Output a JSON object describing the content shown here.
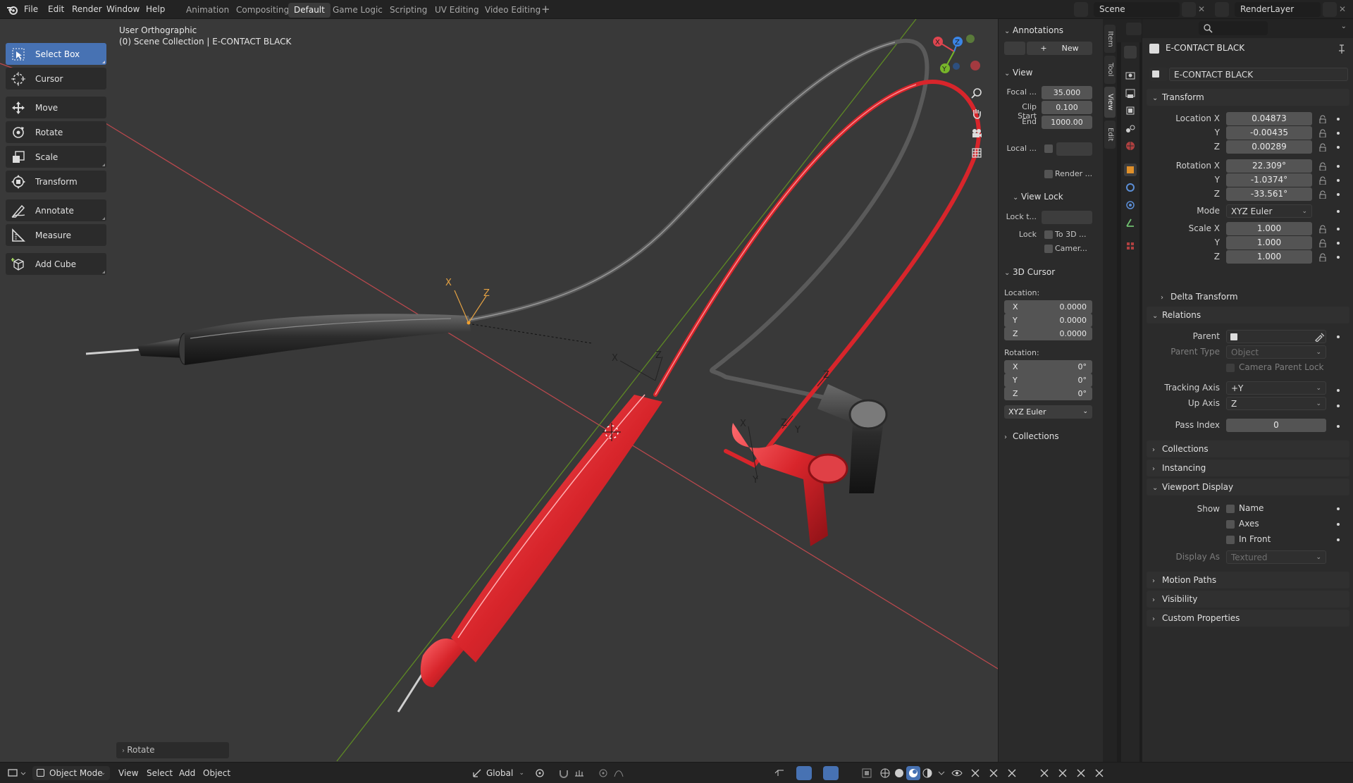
{
  "menu": [
    "File",
    "Edit",
    "Render",
    "Window",
    "Help"
  ],
  "workspaces": [
    "Animation",
    "Compositing",
    "Default",
    "Game Logic",
    "Scripting",
    "UV Editing",
    "Video Editing"
  ],
  "active_workspace": "Default",
  "add_workspace_icon": "plus-icon",
  "scene_name": "Scene",
  "view_layer": "RenderLayer",
  "viewport": {
    "view_name": "User Orthographic",
    "collection_line": "(0) Scene Collection | E-CONTACT BLACK"
  },
  "tools": [
    {
      "label": "Select Box",
      "icon": "select-box-icon",
      "active": true
    },
    {
      "label": "Cursor",
      "icon": "cursor-icon"
    },
    {
      "label": "Move",
      "icon": "move-icon"
    },
    {
      "label": "Rotate",
      "icon": "rotate-icon"
    },
    {
      "label": "Scale",
      "icon": "scale-icon"
    },
    {
      "label": "Transform",
      "icon": "transform-icon"
    },
    {
      "label": "Annotate",
      "icon": "annotate-icon"
    },
    {
      "label": "Measure",
      "icon": "measure-icon"
    },
    {
      "label": "Add Cube",
      "icon": "add-cube-icon"
    }
  ],
  "npanel": {
    "annotations": {
      "title": "Annotations",
      "new_label": "New"
    },
    "view": {
      "title": "View",
      "focal_label": "Focal ...",
      "focal_value": "35.000",
      "clip_start_label": "Clip Start",
      "clip_start_value": "0.100",
      "end_label": "End",
      "end_value": "1000.00",
      "local_label": "Local ...",
      "render_label": "Render ..."
    },
    "view_lock": {
      "title": "View Lock",
      "lock_to_label": "Lock t...",
      "lock_label": "Lock",
      "to3d_label": "To 3D ...",
      "camera_label": "Camer..."
    },
    "cursor3d": {
      "title": "3D Cursor",
      "location_label": "Location:",
      "loc_x": "0.0000",
      "loc_y": "0.0000",
      "loc_z": "0.0000",
      "rotation_label": "Rotation:",
      "rot_x": "0°",
      "rot_y": "0°",
      "rot_z": "0°",
      "axis_x": "X",
      "axis_y": "Y",
      "axis_z": "Z",
      "mode": "XYZ Euler"
    },
    "collections": {
      "title": "Collections"
    },
    "tabs": [
      "Item",
      "Tool",
      "View",
      "Edit"
    ],
    "active_tab": "View"
  },
  "properties": {
    "object_name": "E-CONTACT BLACK",
    "data_name": "E-CONTACT BLACK",
    "transform": {
      "title": "Transform",
      "location_x_label": "Location X",
      "location_x": "0.04873",
      "y_label": "Y",
      "location_y": "-0.00435",
      "z_label": "Z",
      "location_z": "0.00289",
      "rotation_x_label": "Rotation X",
      "rotation_x": "22.309°",
      "rotation_y": "-1.0374°",
      "rotation_z": "-33.561°",
      "mode_label": "Mode",
      "mode": "XYZ Euler",
      "scale_x_label": "Scale X",
      "scale_x": "1.000",
      "scale_y": "1.000",
      "scale_z": "1.000"
    },
    "delta_transform": "Delta Transform",
    "relations": {
      "title": "Relations",
      "parent_label": "Parent",
      "parent_type_label": "Parent Type",
      "parent_type": "Object",
      "camera_parent_lock": "Camera Parent Lock",
      "tracking_axis_label": "Tracking Axis",
      "tracking_axis": "+Y",
      "up_axis_label": "Up Axis",
      "up_axis": "Z",
      "pass_index_label": "Pass Index",
      "pass_index": "0"
    },
    "collections": "Collections",
    "instancing": "Instancing",
    "viewport_display": {
      "title": "Viewport Display",
      "show_label": "Show",
      "name": "Name",
      "axes": "Axes",
      "in_front": "In Front",
      "display_as_label": "Display As",
      "display_as": "Textured"
    },
    "motion_paths": "Motion Paths",
    "visibility": "Visibility",
    "custom_properties": "Custom Properties"
  },
  "bottom": {
    "mode": "Object Mode",
    "menus": [
      "View",
      "Select",
      "Add",
      "Object"
    ],
    "orientation": "Global",
    "redo_label": "Rotate"
  },
  "colors": {
    "accent": "#4772b3",
    "red_probe": "#d8252b",
    "black_probe": "#2a2a2a",
    "axis_x": "#e0454f",
    "axis_y": "#77b52a",
    "axis_z": "#3a85e6"
  }
}
